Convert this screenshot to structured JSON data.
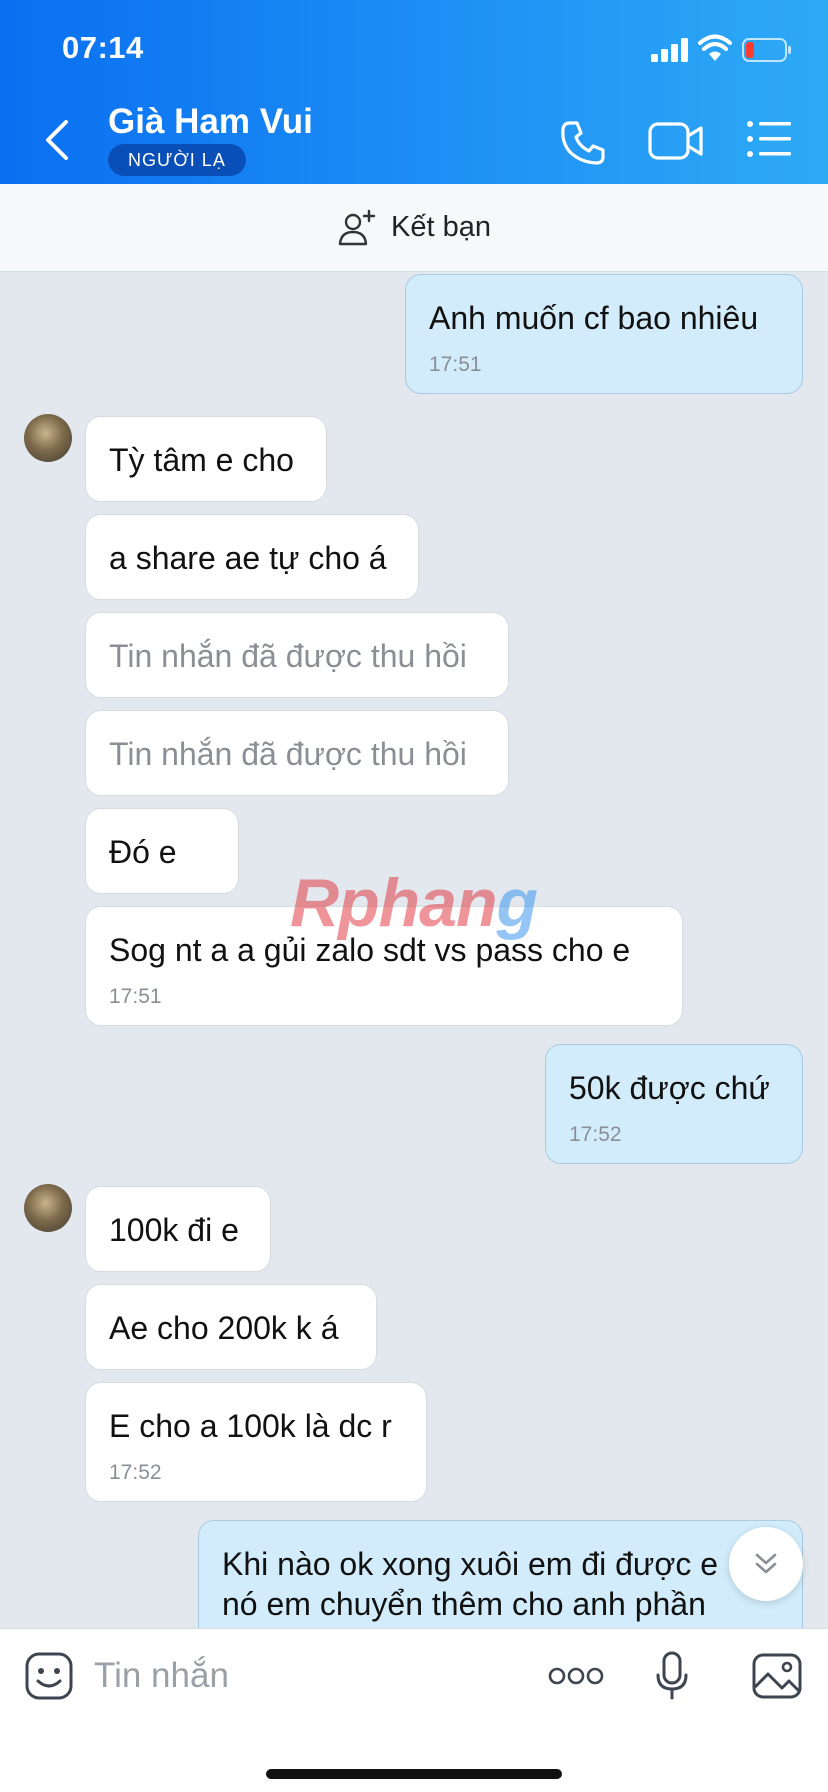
{
  "status_bar": {
    "time": "07:14"
  },
  "header": {
    "title": "Già Ham Vui",
    "badge": "NGƯỜI LẠ",
    "icons": [
      "back-chevron-icon",
      "phone-call-icon",
      "video-call-icon",
      "list-menu-icon"
    ]
  },
  "add_friend": {
    "label": "Kết bạn"
  },
  "messages": [
    {
      "dir": "out",
      "text": "Anh muốn cf bao nhiêu",
      "time": "17:51"
    },
    {
      "dir": "in",
      "text": "Tỳ tâm e cho"
    },
    {
      "dir": "in",
      "text": "a share ae tự cho á"
    },
    {
      "dir": "in",
      "text": "Tin nhắn đã được thu hồi",
      "recalled": true
    },
    {
      "dir": "in",
      "text": "Tin nhắn đã được thu hồi",
      "recalled": true
    },
    {
      "dir": "in",
      "text": "Đó e"
    },
    {
      "dir": "in",
      "text": "Sog nt a a gủi zalo sdt vs pass cho e",
      "time": "17:51"
    },
    {
      "dir": "out",
      "text": "50k được chứ",
      "time": "17:52"
    },
    {
      "dir": "in",
      "text": "100k đi e"
    },
    {
      "dir": "in",
      "text": "Ae cho 200k k á"
    },
    {
      "dir": "in",
      "text": "E cho a 100k là dc r",
      "time": "17:52"
    },
    {
      "dir": "out",
      "text_line1": "Khi nào ok xong xuôi em đi được e",
      "text_line2": "nó em chuyển thêm cho anh phần"
    }
  ],
  "watermark": {
    "part1": "Rphan",
    "part2": "g"
  },
  "composer": {
    "placeholder": "Tin nhắn"
  }
}
